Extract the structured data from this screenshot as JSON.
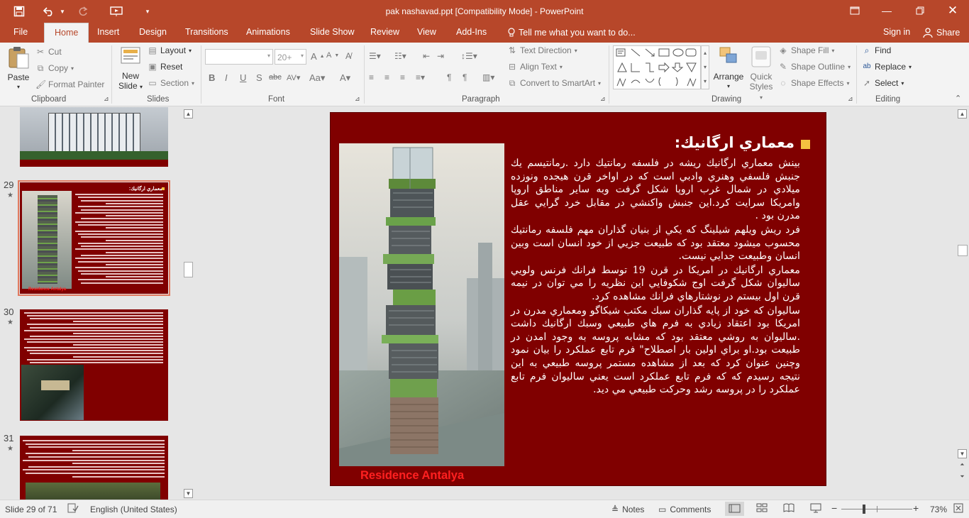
{
  "window": {
    "document_title": "pak nashavad.ppt [Compatibility Mode] - PowerPoint"
  },
  "tabs": [
    "File",
    "Home",
    "Insert",
    "Design",
    "Transitions",
    "Animations",
    "Slide Show",
    "Review",
    "View",
    "Add-Ins"
  ],
  "tell_me": "Tell me what you want to do...",
  "account": {
    "sign_in": "Sign in",
    "share": "Share"
  },
  "ribbon": {
    "clipboard": {
      "paste": "Paste",
      "cut": "Cut",
      "copy": "Copy",
      "format_painter": "Format Painter",
      "label": "Clipboard"
    },
    "slides": {
      "new_slide": "New",
      "new_slide2": "Slide",
      "layout": "Layout",
      "reset": "Reset",
      "section": "Section",
      "label": "Slides"
    },
    "font": {
      "size": "20+",
      "label": "Font"
    },
    "paragraph": {
      "text_direction": "Text Direction",
      "align_text": "Align Text",
      "convert_smartart": "Convert to SmartArt",
      "label": "Paragraph"
    },
    "drawing": {
      "arrange": "Arrange",
      "quick_styles": "Quick",
      "quick_styles2": "Styles",
      "shape_fill": "Shape Fill",
      "shape_outline": "Shape Outline",
      "shape_effects": "Shape Effects",
      "label": "Drawing"
    },
    "editing": {
      "find": "Find",
      "replace": "Replace",
      "select": "Select",
      "label": "Editing"
    }
  },
  "thumbnails": [
    {
      "num": "29"
    },
    {
      "num": "30"
    },
    {
      "num": "31"
    }
  ],
  "slide": {
    "title": "معماري ارگانيك:",
    "paragraphs": [
      "بينش معماري ارگانيك ريشه در فلسفه رمانتيك دارد .رمانتيسم يك جنبش فلسفي وهنري وادبي است كه در اواخر قرن هيجده ونوزده ميلادي در شمال غرب اروپا شكل گرفت وبه ساير مناطق اروپا وامريكا سرايت كرد.اين جنبش واكنشي در مقابل خرد گرايي عقل مدرن بود .",
      "فرد ريش ويلهم شيلينگ  كه يكي از بنيان گذاران مهم فلسفه رمانتيك محسوب ميشود معتقد بود كه طبيعت جزيي از خود انسان است وبين انسان وطبيعت جدايي نيست.",
      "معماري ارگانيك در امريكا در قرن 19 توسط فرانك فرنس ولويي ساليوان شكل گرفت اوج شكوفايي اين نظريه را مي توان در نيمه قرن اول بيستم در نوشتارهاي فرانك مشاهده كرد.",
      "ساليوان كه خود از پايه گذاران سبك مكتب شيكاگو ومعماري مدرن در امريكا بود اعتقاد زيادي به فرم هاي طبيعي وسبك ارگانيك داشت .ساليوان به روشي معتقد بود كه مشابه پروسه به وجود امدن در طبيعت بود.او براي اولين بار اصطلاح\" فرم تابع عملكرد را بيان نمود وچنين عنوان كرد كه بعد از مشاهده مستمر پروسه طبيعي به اين نتيجه رسيدم كه كه فرم تابع عملكرد است يعني ساليوان فرم تابع عملكرد را در پروسه رشد وحركت طبيعي مي ديد."
    ],
    "caption": "Residence Antalya",
    "thumb_caption": "Residence Antalya",
    "thumb_title": "معماري ارگانيك:"
  },
  "status": {
    "slide_of": "Slide 29 of 71",
    "language": "English (United States)",
    "notes": "Notes",
    "comments": "Comments",
    "zoom": "73%"
  },
  "colors": {
    "accent": "#b7472a",
    "slide_bg": "#800000",
    "caption": "#ff2020",
    "bullet": "#f5c140"
  }
}
